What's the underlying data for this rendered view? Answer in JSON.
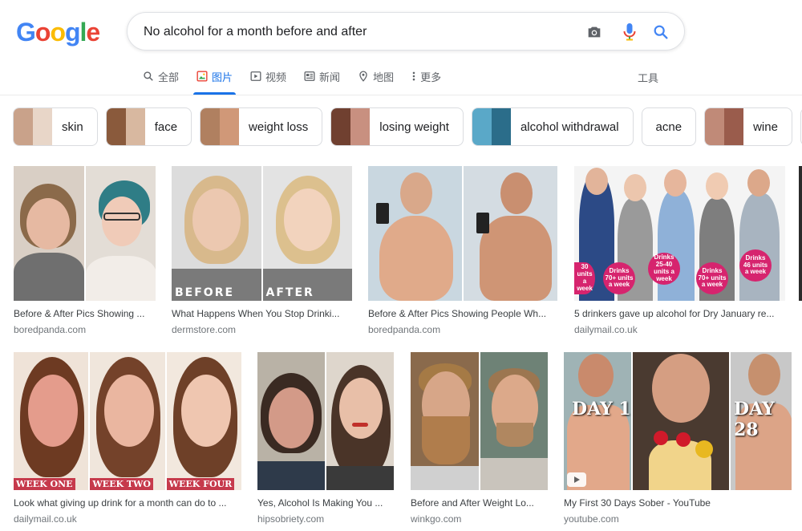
{
  "logo": {
    "text": "Google",
    "letters": [
      "G",
      "o",
      "o",
      "g",
      "l",
      "e"
    ],
    "colors": [
      "#4285f4",
      "#ea4335",
      "#fbbc05",
      "#4285f4",
      "#34a853",
      "#ea4335"
    ]
  },
  "search": {
    "query": "No alcohol for a month before and after"
  },
  "tabs": [
    {
      "label": "全部",
      "icon": "search-icon",
      "active": false
    },
    {
      "label": "图片",
      "icon": "image-icon",
      "active": true
    },
    {
      "label": "视频",
      "icon": "video-icon",
      "active": false
    },
    {
      "label": "新闻",
      "icon": "news-icon",
      "active": false
    },
    {
      "label": "地图",
      "icon": "map-pin-icon",
      "active": false
    },
    {
      "label": "更多",
      "icon": "more-vert-icon",
      "active": false
    }
  ],
  "tools_label": "工具",
  "chips": [
    {
      "label": "skin",
      "colors": [
        "#c9a28a",
        "#e8d6c8"
      ]
    },
    {
      "label": "face",
      "colors": [
        "#8a5a3c",
        "#d8b8a0"
      ]
    },
    {
      "label": "weight loss",
      "colors": [
        "#b08060",
        "#d09878"
      ]
    },
    {
      "label": "losing weight",
      "colors": [
        "#704030",
        "#c89080"
      ]
    },
    {
      "label": "alcohol withdrawal",
      "colors": [
        "#5aa8c8",
        "#2b6d8a"
      ]
    },
    {
      "label": "acne",
      "colors": []
    },
    {
      "label": "wine",
      "colors": [
        "#c08a78",
        "#9a5c4c"
      ]
    },
    {
      "label": "wi",
      "colors": []
    }
  ],
  "results": [
    {
      "caption": "Before & After Pics Showing ...",
      "source": "boredpanda.com"
    },
    {
      "caption": "What Happens When You Stop Drinki...",
      "source": "dermstore.com",
      "labels": [
        "BEFORE",
        "AFTER"
      ]
    },
    {
      "caption": "Before & After Pics Showing People Wh...",
      "source": "boredpanda.com"
    },
    {
      "caption": "5 drinkers gave up alcohol for Dry January re...",
      "source": "dailymail.co.uk",
      "badges": [
        "Drinks 70+ units a week",
        "Drinks 25-40 units a week",
        "Drinks 70+ units a week",
        "Drinks 46 units a week",
        "30 units a week"
      ]
    },
    {
      "caption": "Look what giving up drink for a month can do to ...",
      "source": "dailymail.co.uk",
      "labels": [
        "WEEK ONE",
        "WEEK TWO",
        "WEEK FOUR"
      ]
    },
    {
      "caption": "Yes, Alcohol Is Making You ...",
      "source": "hipsobriety.com"
    },
    {
      "caption": "Before and After Weight Lo...",
      "source": "winkgo.com"
    },
    {
      "caption": "My First 30 Days Sober - YouTube",
      "source": "youtube.com",
      "labels": [
        "DAY 1",
        "DAY 28"
      ]
    }
  ]
}
